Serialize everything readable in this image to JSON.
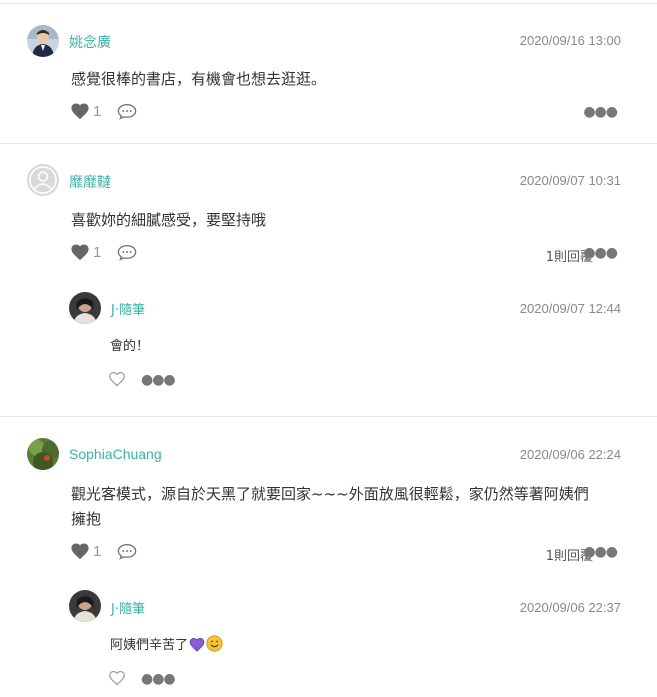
{
  "colors": {
    "author": "#3bb3a4",
    "heart": "#666666",
    "divider": "#e6e6e6",
    "emoji_heart": "#8a5cd1",
    "emoji_smile": "#f7c531"
  },
  "comments": [
    {
      "author": "姚念廣",
      "timestamp": "2020/09/16 13:00",
      "text": "感覺很棒的書店，有機會也想去逛逛。",
      "likes": "1",
      "avatar_icon": "person-photo-avatar",
      "more_icon": "more-dots-icon"
    },
    {
      "author": "靡靡韃",
      "timestamp": "2020/09/07 10:31",
      "text": "喜歡妳的細膩感受，要堅持哦",
      "likes": "1",
      "reply_count_label": "1則回覆",
      "avatar_icon": "default-avatar",
      "reply": {
        "author": "J‧隨筆",
        "timestamp": "2020/09/07 12:44",
        "text": "會的！"
      }
    },
    {
      "author": "SophiaChuang",
      "timestamp": "2020/09/06 22:24",
      "text_line1": "觀光客模式，源自於天黑了就要回家~~~外面放風很輕鬆，家仍然等著阿姨們",
      "text_line2": "擁抱",
      "likes": "1",
      "reply_count_label": "1則回覆",
      "avatar_icon": "nature-photo-avatar",
      "reply": {
        "author": "J‧隨筆",
        "timestamp": "2020/09/06 22:37",
        "text": "阿姨們辛苦了"
      }
    }
  ]
}
